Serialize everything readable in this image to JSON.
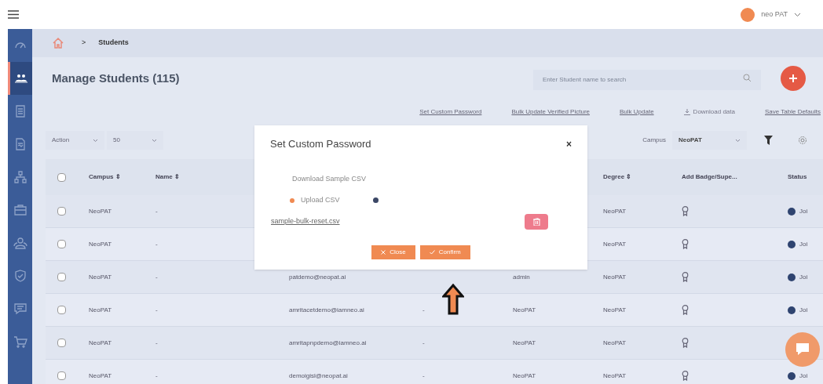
{
  "topbar": {
    "user": "neo PAT"
  },
  "sidebar": {
    "items": [
      {
        "kind": "gauge",
        "selected": false
      },
      {
        "kind": "users",
        "selected": true
      },
      {
        "kind": "document",
        "selected": false
      },
      {
        "kind": "report",
        "selected": false
      },
      {
        "kind": "hierarchy",
        "selected": false
      },
      {
        "kind": "briefcase",
        "selected": false
      },
      {
        "kind": "group",
        "selected": false
      },
      {
        "kind": "shield",
        "selected": false
      },
      {
        "kind": "chat",
        "selected": false
      },
      {
        "kind": "cart",
        "selected": false
      }
    ]
  },
  "breadcrumb": [
    ">",
    "Students"
  ],
  "page_title": "Manage Students (115)",
  "search": {
    "placeholder": "Enter Student name to search"
  },
  "links": [
    {
      "label": "Set Custom Password",
      "kind": "link"
    },
    {
      "label": "Bulk Update Verified Picture",
      "kind": "link"
    },
    {
      "label": "Bulk Update",
      "kind": "link"
    },
    {
      "label": "Download data",
      "kind": "download"
    },
    {
      "label": "Save Table Defaults",
      "kind": "link"
    }
  ],
  "filters": {
    "action": "Action",
    "page_size": "50",
    "campus_label": "Campus",
    "campus": "NeoPAT"
  },
  "table": {
    "select_all_checked": false,
    "columns": [
      {
        "label": "Campus ⇕"
      },
      {
        "label": "Name ⇕"
      },
      {
        "label": "Degree ⇕"
      },
      {
        "label": "Add Badge/Supe..."
      },
      {
        "label": "Status"
      }
    ],
    "rows": [
      {
        "checked": false,
        "campus": "NeoPAT",
        "name": "-",
        "degree": "NeoPAT",
        "status": "Joi"
      },
      {
        "checked": false,
        "campus": "NeoPAT",
        "name": "-",
        "degree": "NeoPAT",
        "status": "Joi"
      },
      {
        "checked": false,
        "campus": "NeoPAT",
        "name": "-",
        "email": "patdemo@neopat.ai",
        "column_5": "admin",
        "degree": "NeoPAT",
        "status": "Joi"
      },
      {
        "checked": false,
        "campus": "NeoPAT",
        "name": "-",
        "email": "amritacetdemo@iamneo.ai",
        "column_4": "-",
        "column_5": "NeoPAT",
        "degree": "NeoPAT",
        "status": "Joi"
      },
      {
        "checked": false,
        "campus": "NeoPAT",
        "name": "-",
        "email": "amritapnpdemo@iamneo.ai",
        "column_4": "-",
        "column_5": "NeoPAT",
        "degree": "NeoPAT"
      },
      {
        "checked": false,
        "campus": "NeoPAT",
        "name": "-",
        "email": "demoigisl@neopat.ai",
        "column_4": "-",
        "column_5": "NeoPAT",
        "degree": "NeoPAT",
        "status": "Joi"
      }
    ]
  },
  "modal": {
    "title": "Set Custom Password",
    "close": "×",
    "download_label": "Download Sample CSV",
    "option": {
      "label": "Upload CSV",
      "selected": true
    },
    "file_link": "sample-bulk-reset.csv",
    "buttons": [
      {
        "label": "Close",
        "kind": "close"
      },
      {
        "label": "Confirm",
        "kind": "confirm"
      }
    ]
  }
}
